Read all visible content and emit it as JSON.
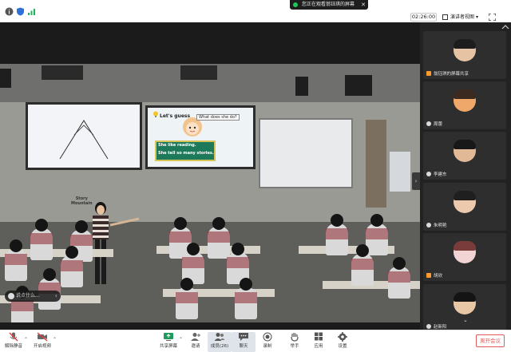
{
  "top_bar": {
    "share_banner": "您正在观看翁钰琪的屏幕",
    "timer": "02:26:00",
    "view_label": "演讲者视图"
  },
  "stage": {
    "lesson_title": "Let's guess",
    "lesson_question": "What does she do?",
    "lesson_line1": "She like  reading.",
    "lesson_line2": "She tell  so many stories.",
    "story_label": "Story\nMountain",
    "chat_preview": "说点什么..."
  },
  "participants": [
    {
      "name": "翁钰琪的屏幕共享",
      "face": "#e6c3a3",
      "hair": "#1d1d1d",
      "host": true
    },
    {
      "name": "周蕾",
      "face": "#f0a86a",
      "hair": "#3b2a20",
      "host": false
    },
    {
      "name": "李建东",
      "face": "#e2b996",
      "hair": "#181818",
      "host": false
    },
    {
      "name": "朱明艳",
      "face": "#ecc8ac",
      "hair": "#1f1f1f",
      "host": false
    },
    {
      "name": "胡欣",
      "face": "#f3d4d4",
      "hair": "#7a3b3b",
      "host": true
    },
    {
      "name": "赵新阳",
      "face": "#e8c7a7",
      "hair": "#141414",
      "host": false
    }
  ],
  "toolbar": {
    "unmute": "解除静音",
    "start_video": "开启视频",
    "share_screen": "共享屏幕",
    "invite": "邀请",
    "members": "成员(26)",
    "chat": "聊天",
    "record": "录制",
    "raise_hand": "举手",
    "apps": "应用",
    "settings": "设置",
    "leave": "离开会议"
  },
  "colors": {
    "leave_red": "#e35a5a",
    "sidebar_bg": "#222222",
    "stage_bg": "#1b1b1b",
    "board_green": "#1c7a5b"
  }
}
